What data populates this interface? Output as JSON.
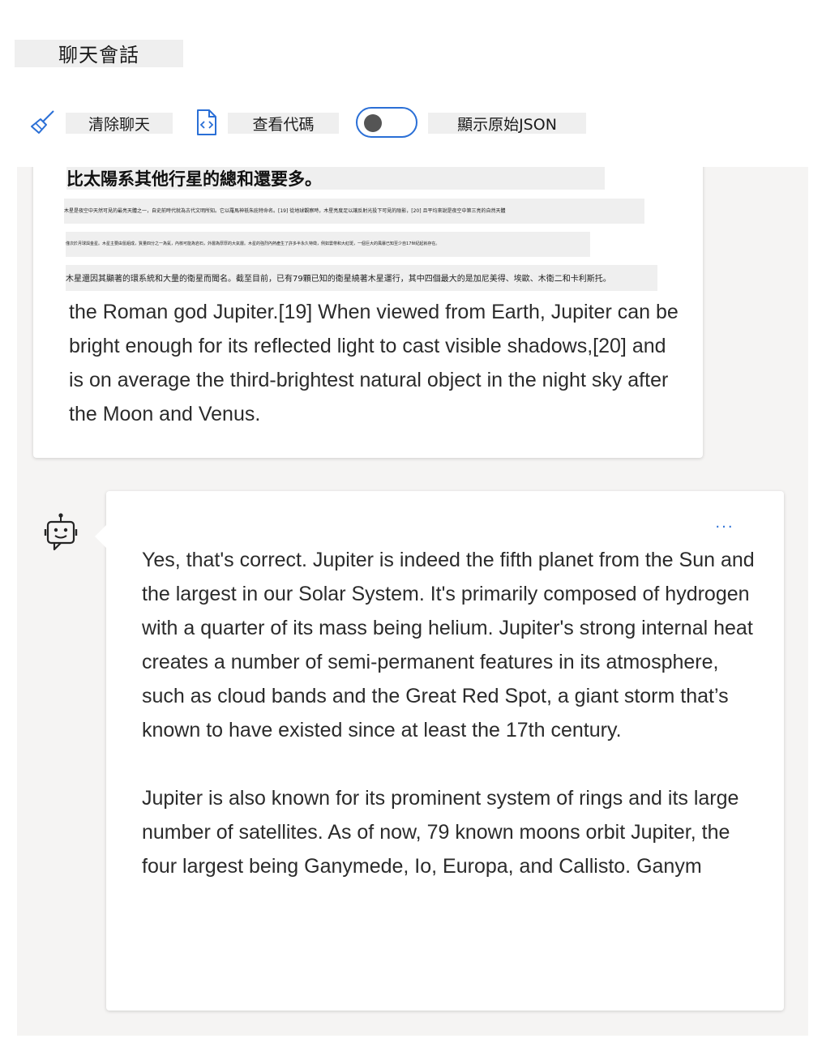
{
  "header": {
    "title": "聊天會話"
  },
  "toolbar": {
    "clear_label": "清除聊天",
    "clear_icon": "broom-icon",
    "view_code_label": "查看代碼",
    "view_code_icon": "code-file-icon",
    "show_json_label": "顯示原始JSON",
    "show_json_toggle_on": false
  },
  "user_message": {
    "zh_line1": "比太陽系其他行星的總和還要多。",
    "zh_line2": "木星是夜空中天然可見的最亮天體之一，自史前時代就為古代文明所知。它以羅馬神祇朱庇特命名。[19] 從地球觀察時，木星亮度足以讓反射光投下可見的陰影，[20] 且平均來說是夜空中第三亮的自然天體",
    "zh_line3": "僅次於月球與金星。木星主要由氫組成，質量四分之一為氦，內核可能為岩石，外層為厚厚的大氣層。木星的強烈內熱產生了許多半永久特徵，例如雲帶和大紅斑，一個巨大的風暴已知至少自17世紀起就存在。",
    "zh_line4": "木星還因其顯著的環系統和大量的衛星而聞名。截至目前，已有79顆已知的衛星繞著木星運行，其中四個最大的是加尼美得、埃歐、木衛二和卡利斯托。",
    "en_text": "the Roman god Jupiter.[19] When viewed from Earth, Jupiter can be bright enough for its reflected light to cast visible shadows,[20] and is on average the third-brightest natural object in the night sky after the Moon and Venus."
  },
  "assistant_message": {
    "avatar_icon": "bot-icon",
    "more_label": "...",
    "paragraph1": "Yes, that's correct. Jupiter is indeed the fifth planet from the Sun and the largest in our Solar System. It's primarily composed of hydrogen with a quarter of its mass being helium. Jupiter's strong internal heat creates a number of semi-permanent features in its atmosphere, such as cloud bands and the Great Red Spot, a giant storm that’s known to have existed since at least the 17th century.",
    "paragraph2": "Jupiter is also known for its prominent system of rings and its large number of satellites. As of now, 79 known moons orbit Jupiter, the four largest being Ganymede, Io, Europa, and Callisto. Ganym"
  },
  "colors": {
    "accent": "#2a6fd6",
    "chat_bg": "#f5f4f3",
    "label_bg": "#efefef"
  }
}
